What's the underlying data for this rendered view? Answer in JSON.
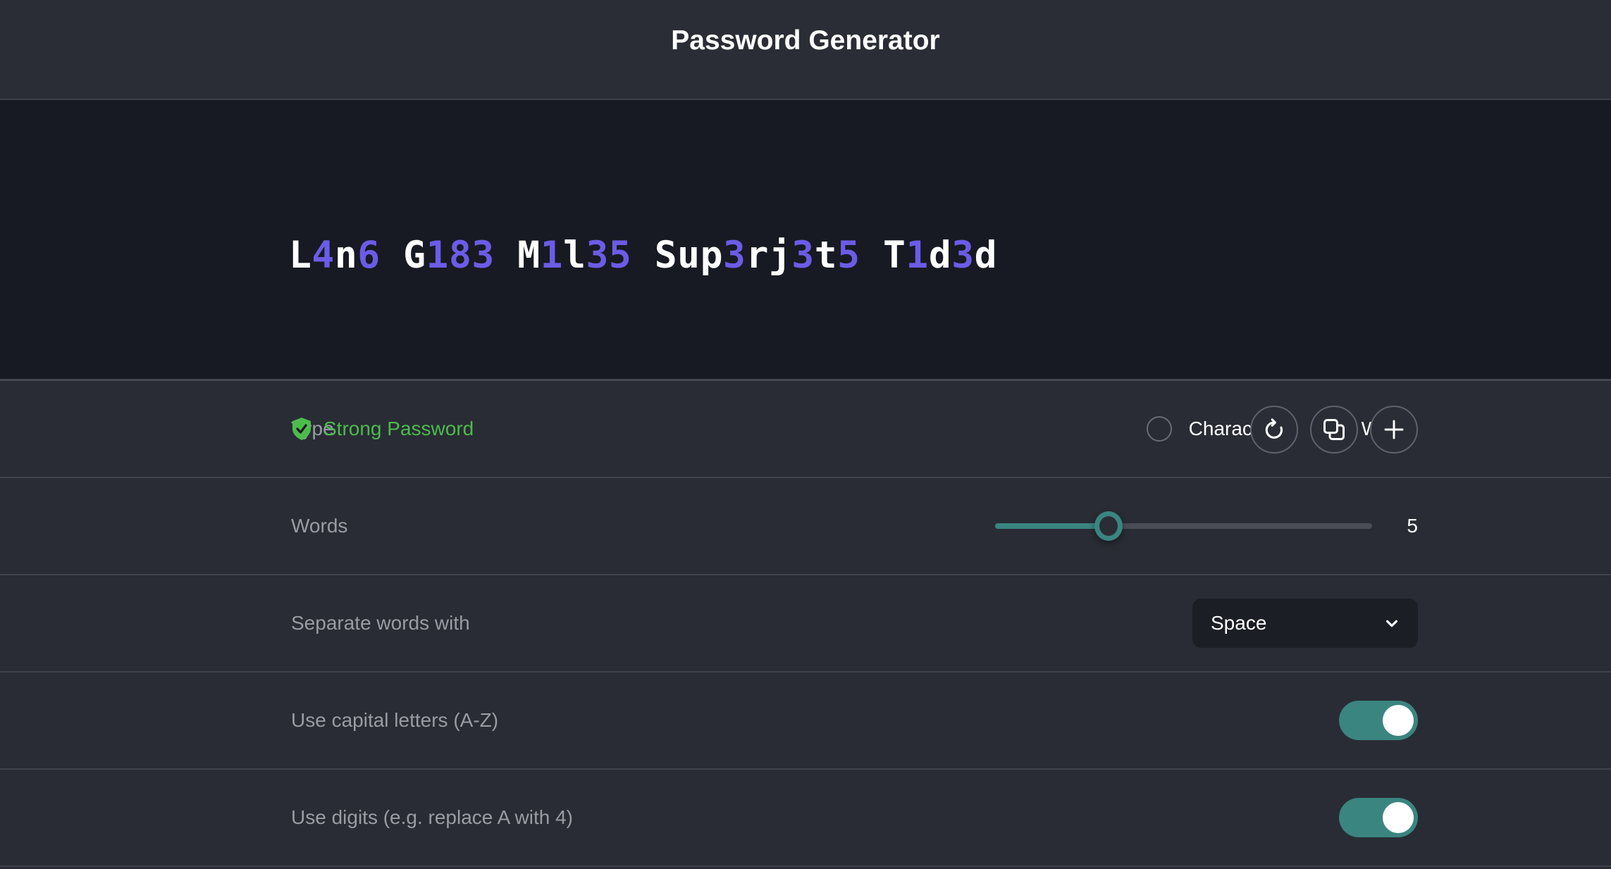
{
  "header": {
    "title": "Password Generator"
  },
  "password": {
    "value": "L4n6 G183 M1l35 Sup3rj3t5 T1d3d",
    "digit_color": "#6b5ce7",
    "strength": "Strong Password",
    "strength_color": "#4cbb4c"
  },
  "actions": [
    {
      "icon": "refresh-icon"
    },
    {
      "icon": "copy-icon"
    },
    {
      "icon": "plus-icon"
    }
  ],
  "settings": {
    "type": {
      "label": "Type",
      "options": [
        "Characters",
        "Words"
      ],
      "selected": "Words"
    },
    "words": {
      "label": "Words",
      "value": "5",
      "fill_fraction": 0.3
    },
    "separator": {
      "label": "Separate words with",
      "value": "Space"
    },
    "capitals": {
      "label": "Use capital letters (A-Z)",
      "on": true
    },
    "digits": {
      "label": "Use digits (e.g. replace A with 4)",
      "on": true
    }
  },
  "colors": {
    "accent": "#3a8580",
    "background": "#292c34",
    "password_bg": "#171a22"
  }
}
